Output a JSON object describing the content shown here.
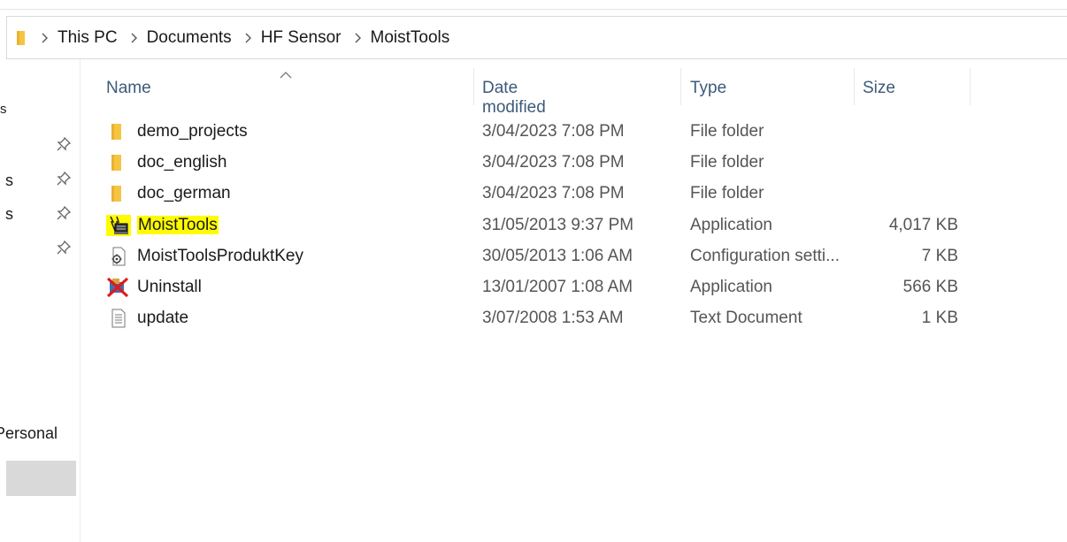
{
  "breadcrumb": [
    "This PC",
    "Documents",
    "HF Sensor",
    "MoistTools"
  ],
  "nav": {
    "fragments": [
      "s",
      "s",
      "s"
    ],
    "personal": "Personal"
  },
  "columns": {
    "name": "Name",
    "date": "Date modified",
    "type": "Type",
    "size": "Size"
  },
  "files": [
    {
      "name": "demo_projects",
      "date": "3/04/2023 7:08 PM",
      "type": "File folder",
      "size": "",
      "icon": "folder-icon"
    },
    {
      "name": "doc_english",
      "date": "3/04/2023 7:08 PM",
      "type": "File folder",
      "size": "",
      "icon": "folder-icon"
    },
    {
      "name": "doc_german",
      "date": "3/04/2023 7:08 PM",
      "type": "File folder",
      "size": "",
      "icon": "folder-icon"
    },
    {
      "name": "MoistTools",
      "date": "31/05/2013 9:37 PM",
      "type": "Application",
      "size": "4,017 KB",
      "icon": "moisttools-app-icon",
      "highlighted": true
    },
    {
      "name": "MoistToolsProduktKey",
      "date": "30/05/2013 1:06 AM",
      "type": "Configuration setti...",
      "size": "7 KB",
      "icon": "config-file-icon"
    },
    {
      "name": "Uninstall",
      "date": "13/01/2007 1:08 AM",
      "type": "Application",
      "size": "566 KB",
      "icon": "uninstall-app-icon"
    },
    {
      "name": "update",
      "date": "3/07/2008 1:53 AM",
      "type": "Text Document",
      "size": "1 KB",
      "icon": "text-document-icon"
    }
  ],
  "colors": {
    "header_text": "#3d5a7a",
    "highlight": "#fffb00",
    "folder": "#f5c542",
    "selection": "#d9d9d9"
  }
}
